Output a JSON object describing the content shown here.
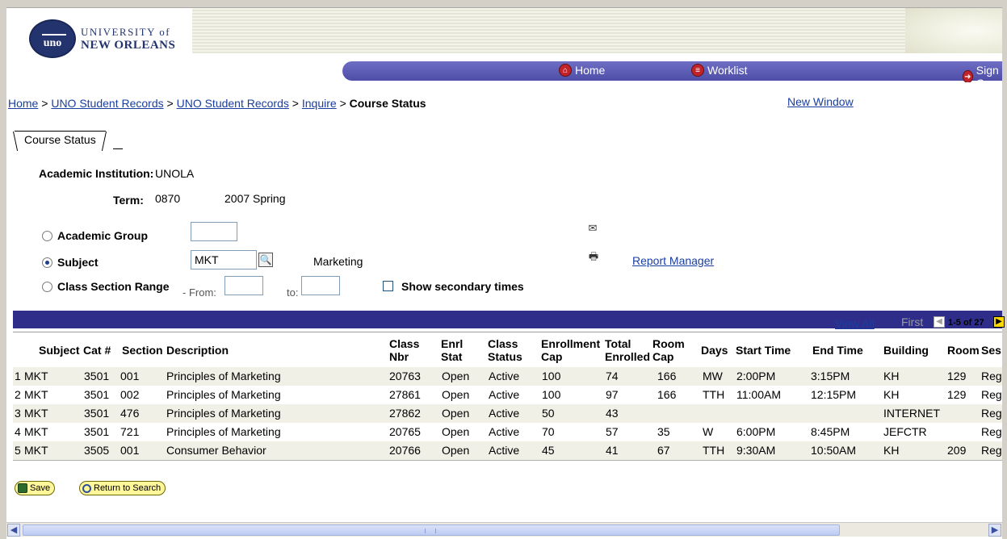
{
  "header": {
    "logo": {
      "line1": "UNIVERSITY of",
      "line2": "NEW ORLEANS",
      "seal": "uno"
    },
    "nav": {
      "home": "Home",
      "worklist": "Worklist",
      "signout": "Sign C"
    }
  },
  "breadcrumb": {
    "items": [
      "Home",
      "UNO Student Records",
      "UNO Student Records",
      "Inquire"
    ],
    "separator": ">",
    "current": "Course Status"
  },
  "new_window": "New Window",
  "tab": {
    "label": "Course Status"
  },
  "form": {
    "institution_label": "Academic Institution:",
    "institution_value": "UNOLA",
    "term_label": "Term:",
    "term_code": "0870",
    "term_desc": "2007 Spring",
    "academic_group_label": "Academic Group",
    "academic_group_value": "",
    "subject_label": "Subject",
    "subject_value": "MKT",
    "subject_desc": "Marketing",
    "class_range_label": "Class Section Range",
    "from_label": "- From:",
    "to_label": "to:",
    "from_value": "",
    "to_value": "",
    "secondary_label": "Show secondary times",
    "selected_option": "Subject",
    "report_manager": "Report Manager"
  },
  "grid": {
    "view_all": "View All",
    "first": "First",
    "pager": "1-5 of 27",
    "headers": {
      "subject": "Subject",
      "cat": "Cat #",
      "section": "Section",
      "description": "Description",
      "class_nbr_1": "Class",
      "class_nbr_2": "Nbr",
      "enrl_stat_1": "Enrl",
      "enrl_stat_2": "Stat",
      "class_status_1": "Class",
      "class_status_2": "Status",
      "enroll_cap_1": "Enrollment",
      "enroll_cap_2": "Cap",
      "total_enrolled_1": "Total",
      "total_enrolled_2": "Enrolled",
      "room_cap_1": "Room",
      "room_cap_2": "Cap",
      "days": "Days",
      "start_time": "Start Time",
      "end_time": "End Time",
      "building": "Building",
      "room": "Room",
      "session": "Ses"
    },
    "rows": [
      {
        "num": "1",
        "subject": "MKT",
        "cat": "3501",
        "section": "001",
        "description": "Principles of Marketing",
        "class_nbr": "20763",
        "enrl_stat": "Open",
        "class_status": "Active",
        "enroll_cap": "100",
        "total_enrolled": "74",
        "room_cap": "166",
        "days": "MW",
        "start_time": "2:00PM",
        "end_time": "3:15PM",
        "building": "KH",
        "room": "129",
        "session": "Reg"
      },
      {
        "num": "2",
        "subject": "MKT",
        "cat": "3501",
        "section": "002",
        "description": "Principles of Marketing",
        "class_nbr": "27861",
        "enrl_stat": "Open",
        "class_status": "Active",
        "enroll_cap": "100",
        "total_enrolled": "97",
        "room_cap": "166",
        "days": "TTH",
        "start_time": "11:00AM",
        "end_time": "12:15PM",
        "building": "KH",
        "room": "129",
        "session": "Reg"
      },
      {
        "num": "3",
        "subject": "MKT",
        "cat": "3501",
        "section": "476",
        "description": "Principles of Marketing",
        "class_nbr": "27862",
        "enrl_stat": "Open",
        "class_status": "Active",
        "enroll_cap": "50",
        "total_enrolled": "43",
        "room_cap": "",
        "days": "",
        "start_time": "",
        "end_time": "",
        "building": "INTERNET",
        "room": "",
        "session": "Reg"
      },
      {
        "num": "4",
        "subject": "MKT",
        "cat": "3501",
        "section": "721",
        "description": "Principles of Marketing",
        "class_nbr": "20765",
        "enrl_stat": "Open",
        "class_status": "Active",
        "enroll_cap": "70",
        "total_enrolled": "57",
        "room_cap": "35",
        "days": "W",
        "start_time": "6:00PM",
        "end_time": "8:45PM",
        "building": "JEFCTR",
        "room": "",
        "session": "Reg"
      },
      {
        "num": "5",
        "subject": "MKT",
        "cat": "3505",
        "section": "001",
        "description": "Consumer Behavior",
        "class_nbr": "20766",
        "enrl_stat": "Open",
        "class_status": "Active",
        "enroll_cap": "45",
        "total_enrolled": "41",
        "room_cap": "67",
        "days": "TTH",
        "start_time": "9:30AM",
        "end_time": "10:50AM",
        "building": "KH",
        "room": "209",
        "session": "Reg"
      }
    ]
  },
  "buttons": {
    "save": "Save",
    "return_to_search": "Return to Search"
  },
  "colors": {
    "grid_bar": "#2e2e8a",
    "nav_bar": "#5a5ab4",
    "link": "#1a3ea0",
    "button_bg": "#fff79a",
    "alt_row": "#f0f0e6"
  }
}
